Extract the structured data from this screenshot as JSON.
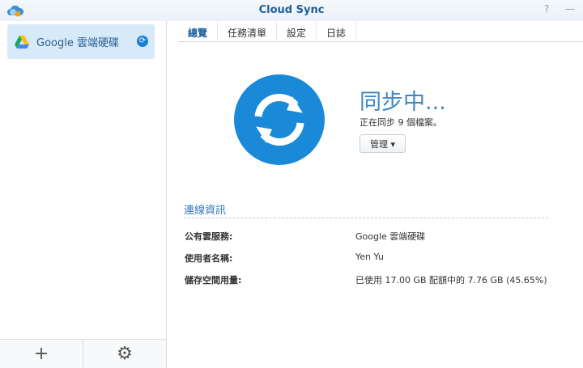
{
  "window": {
    "title": "Cloud Sync",
    "help": "?",
    "minimize": "—"
  },
  "sidebar": {
    "items": [
      {
        "label": "Google 雲端硬碟",
        "status": "syncing"
      }
    ],
    "add": "+",
    "settings": "⚙"
  },
  "tabs": [
    {
      "label": "總覽",
      "active": true
    },
    {
      "label": "任務清單"
    },
    {
      "label": "設定"
    },
    {
      "label": "日誌"
    }
  ],
  "overview": {
    "status": "同步中...",
    "detail": "正在同步 9 個檔案。",
    "manage_label": "管理 ▾"
  },
  "connection": {
    "title": "連線資訊",
    "rows": [
      {
        "key": "公有雲服務:",
        "value": "Google 雲端硬碟"
      },
      {
        "key": "使用者名稱:",
        "value": "Yen Yu"
      },
      {
        "key": "儲存空間用量:",
        "value": "已使用 17.00 GB 配額中的 7.76 GB (45.65%)"
      }
    ]
  },
  "colors": {
    "accent": "#1a8ad8"
  }
}
